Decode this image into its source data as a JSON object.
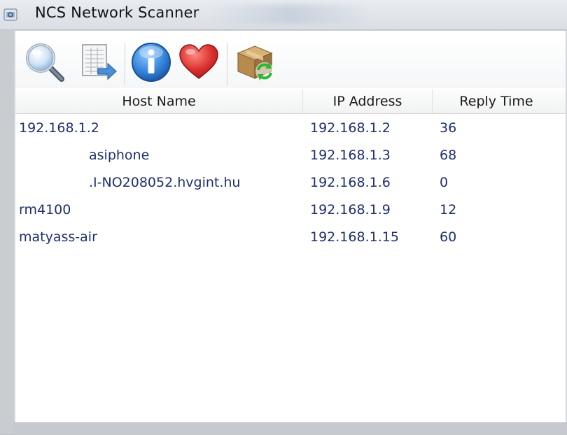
{
  "window": {
    "title": "NCS Network Scanner"
  },
  "toolbar": {
    "buttons": [
      {
        "name": "scan",
        "icon": "magnifier-icon"
      },
      {
        "name": "export",
        "icon": "export-document-icon"
      },
      {
        "name": "about",
        "icon": "info-icon"
      },
      {
        "name": "favorite",
        "icon": "heart-icon"
      },
      {
        "name": "update",
        "icon": "package-refresh-icon"
      }
    ]
  },
  "table": {
    "columns": [
      "Host Name",
      "IP Address",
      "Reply Time"
    ],
    "rows": [
      {
        "host": "192.168.1.2",
        "ip": "192.168.1.2",
        "reply": "36"
      },
      {
        "host": "asiphone",
        "ip": "192.168.1.3",
        "reply": "68"
      },
      {
        "host": ".I-NO208052.hvgint.hu",
        "ip": "192.168.1.6",
        "reply": "0"
      },
      {
        "host": "rm4100",
        "ip": "192.168.1.9",
        "reply": "12"
      },
      {
        "host": "matyass-air",
        "ip": "192.168.1.15",
        "reply": "60"
      }
    ]
  },
  "colors": {
    "row_text": "#1f2f6e",
    "heart": "#d9302e",
    "info": "#2f7fd6"
  }
}
